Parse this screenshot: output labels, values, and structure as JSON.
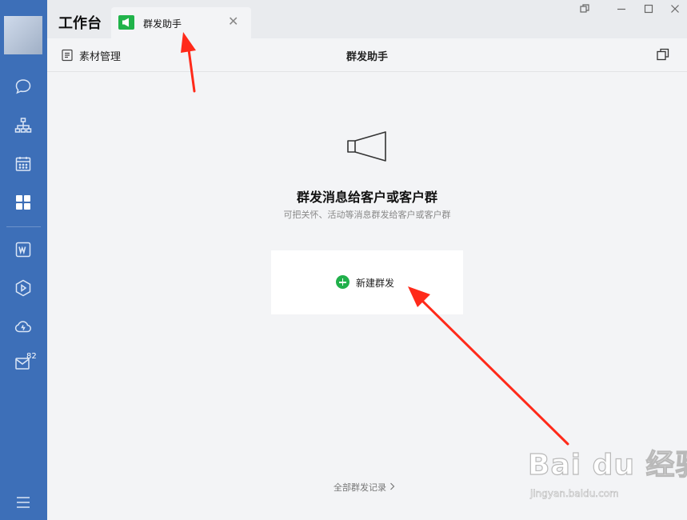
{
  "window": {
    "app_title": "工作台",
    "controls": [
      "restore-window-icon",
      "minimize-icon",
      "maximize-icon",
      "close-icon"
    ]
  },
  "tab": {
    "label": "群发助手",
    "icon": "megaphone-icon",
    "close": "✕"
  },
  "sidebar": {
    "items": [
      {
        "icon": "chat-icon"
      },
      {
        "icon": "org-chart-icon"
      },
      {
        "icon": "calendar-icon"
      },
      {
        "icon": "workbench-grid-icon",
        "active": true
      },
      {
        "icon": "word-doc-icon"
      },
      {
        "icon": "play-hexagon-icon"
      },
      {
        "icon": "cloud-icon"
      },
      {
        "icon": "mail-icon",
        "badge": "82"
      },
      {
        "icon": "menu-icon"
      }
    ]
  },
  "toolbar": {
    "materials_label": "素材管理",
    "page_title": "群发助手",
    "new_window_icon": "open-new-window-icon"
  },
  "main": {
    "headline": "群发消息给客户或客户群",
    "subline": "可把关怀、活动等消息群发给客户或客户群",
    "new_button_label": "新建群发",
    "records_label": "全部群发记录"
  },
  "watermark": {
    "brand": "Bai du 经验",
    "url": "jingyan.baidu.com"
  },
  "colors": {
    "sidebar": "#3d6fb8",
    "accent_green": "#21b04b",
    "annotation_red": "#ff2a1a"
  }
}
